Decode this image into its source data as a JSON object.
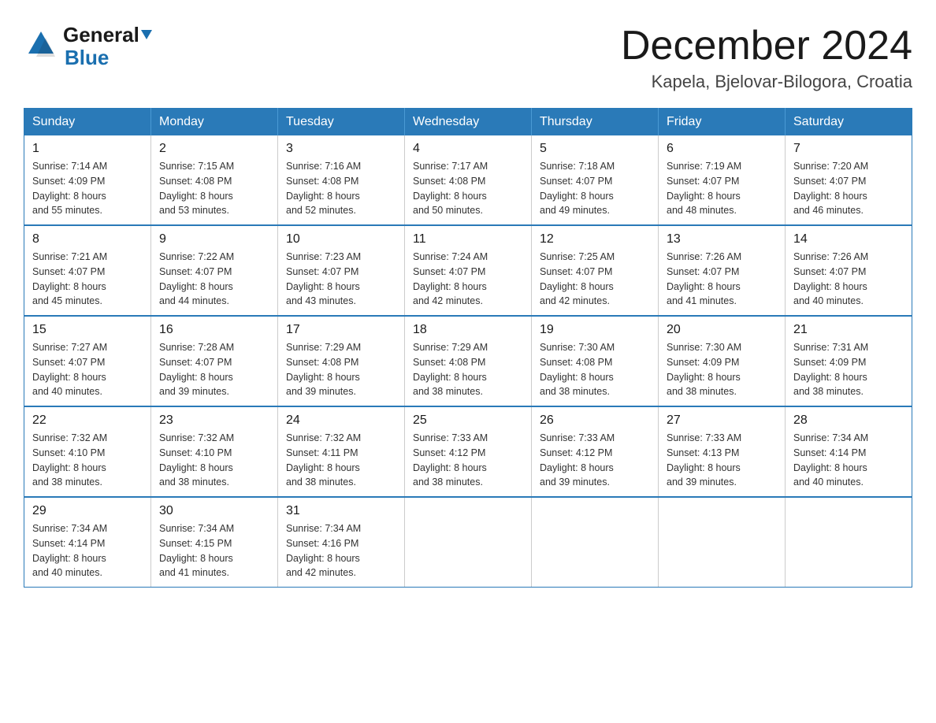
{
  "header": {
    "logo_general": "General",
    "logo_blue": "Blue",
    "month_title": "December 2024",
    "location": "Kapela, Bjelovar-Bilogora, Croatia"
  },
  "weekdays": [
    "Sunday",
    "Monday",
    "Tuesday",
    "Wednesday",
    "Thursday",
    "Friday",
    "Saturday"
  ],
  "weeks": [
    [
      {
        "day": "1",
        "sunrise": "7:14 AM",
        "sunset": "4:09 PM",
        "daylight": "8 hours and 55 minutes."
      },
      {
        "day": "2",
        "sunrise": "7:15 AM",
        "sunset": "4:08 PM",
        "daylight": "8 hours and 53 minutes."
      },
      {
        "day": "3",
        "sunrise": "7:16 AM",
        "sunset": "4:08 PM",
        "daylight": "8 hours and 52 minutes."
      },
      {
        "day": "4",
        "sunrise": "7:17 AM",
        "sunset": "4:08 PM",
        "daylight": "8 hours and 50 minutes."
      },
      {
        "day": "5",
        "sunrise": "7:18 AM",
        "sunset": "4:07 PM",
        "daylight": "8 hours and 49 minutes."
      },
      {
        "day": "6",
        "sunrise": "7:19 AM",
        "sunset": "4:07 PM",
        "daylight": "8 hours and 48 minutes."
      },
      {
        "day": "7",
        "sunrise": "7:20 AM",
        "sunset": "4:07 PM",
        "daylight": "8 hours and 46 minutes."
      }
    ],
    [
      {
        "day": "8",
        "sunrise": "7:21 AM",
        "sunset": "4:07 PM",
        "daylight": "8 hours and 45 minutes."
      },
      {
        "day": "9",
        "sunrise": "7:22 AM",
        "sunset": "4:07 PM",
        "daylight": "8 hours and 44 minutes."
      },
      {
        "day": "10",
        "sunrise": "7:23 AM",
        "sunset": "4:07 PM",
        "daylight": "8 hours and 43 minutes."
      },
      {
        "day": "11",
        "sunrise": "7:24 AM",
        "sunset": "4:07 PM",
        "daylight": "8 hours and 42 minutes."
      },
      {
        "day": "12",
        "sunrise": "7:25 AM",
        "sunset": "4:07 PM",
        "daylight": "8 hours and 42 minutes."
      },
      {
        "day": "13",
        "sunrise": "7:26 AM",
        "sunset": "4:07 PM",
        "daylight": "8 hours and 41 minutes."
      },
      {
        "day": "14",
        "sunrise": "7:26 AM",
        "sunset": "4:07 PM",
        "daylight": "8 hours and 40 minutes."
      }
    ],
    [
      {
        "day": "15",
        "sunrise": "7:27 AM",
        "sunset": "4:07 PM",
        "daylight": "8 hours and 40 minutes."
      },
      {
        "day": "16",
        "sunrise": "7:28 AM",
        "sunset": "4:07 PM",
        "daylight": "8 hours and 39 minutes."
      },
      {
        "day": "17",
        "sunrise": "7:29 AM",
        "sunset": "4:08 PM",
        "daylight": "8 hours and 39 minutes."
      },
      {
        "day": "18",
        "sunrise": "7:29 AM",
        "sunset": "4:08 PM",
        "daylight": "8 hours and 38 minutes."
      },
      {
        "day": "19",
        "sunrise": "7:30 AM",
        "sunset": "4:08 PM",
        "daylight": "8 hours and 38 minutes."
      },
      {
        "day": "20",
        "sunrise": "7:30 AM",
        "sunset": "4:09 PM",
        "daylight": "8 hours and 38 minutes."
      },
      {
        "day": "21",
        "sunrise": "7:31 AM",
        "sunset": "4:09 PM",
        "daylight": "8 hours and 38 minutes."
      }
    ],
    [
      {
        "day": "22",
        "sunrise": "7:32 AM",
        "sunset": "4:10 PM",
        "daylight": "8 hours and 38 minutes."
      },
      {
        "day": "23",
        "sunrise": "7:32 AM",
        "sunset": "4:10 PM",
        "daylight": "8 hours and 38 minutes."
      },
      {
        "day": "24",
        "sunrise": "7:32 AM",
        "sunset": "4:11 PM",
        "daylight": "8 hours and 38 minutes."
      },
      {
        "day": "25",
        "sunrise": "7:33 AM",
        "sunset": "4:12 PM",
        "daylight": "8 hours and 38 minutes."
      },
      {
        "day": "26",
        "sunrise": "7:33 AM",
        "sunset": "4:12 PM",
        "daylight": "8 hours and 39 minutes."
      },
      {
        "day": "27",
        "sunrise": "7:33 AM",
        "sunset": "4:13 PM",
        "daylight": "8 hours and 39 minutes."
      },
      {
        "day": "28",
        "sunrise": "7:34 AM",
        "sunset": "4:14 PM",
        "daylight": "8 hours and 40 minutes."
      }
    ],
    [
      {
        "day": "29",
        "sunrise": "7:34 AM",
        "sunset": "4:14 PM",
        "daylight": "8 hours and 40 minutes."
      },
      {
        "day": "30",
        "sunrise": "7:34 AM",
        "sunset": "4:15 PM",
        "daylight": "8 hours and 41 minutes."
      },
      {
        "day": "31",
        "sunrise": "7:34 AM",
        "sunset": "4:16 PM",
        "daylight": "8 hours and 42 minutes."
      },
      null,
      null,
      null,
      null
    ]
  ],
  "labels": {
    "sunrise": "Sunrise:",
    "sunset": "Sunset:",
    "daylight": "Daylight:"
  }
}
